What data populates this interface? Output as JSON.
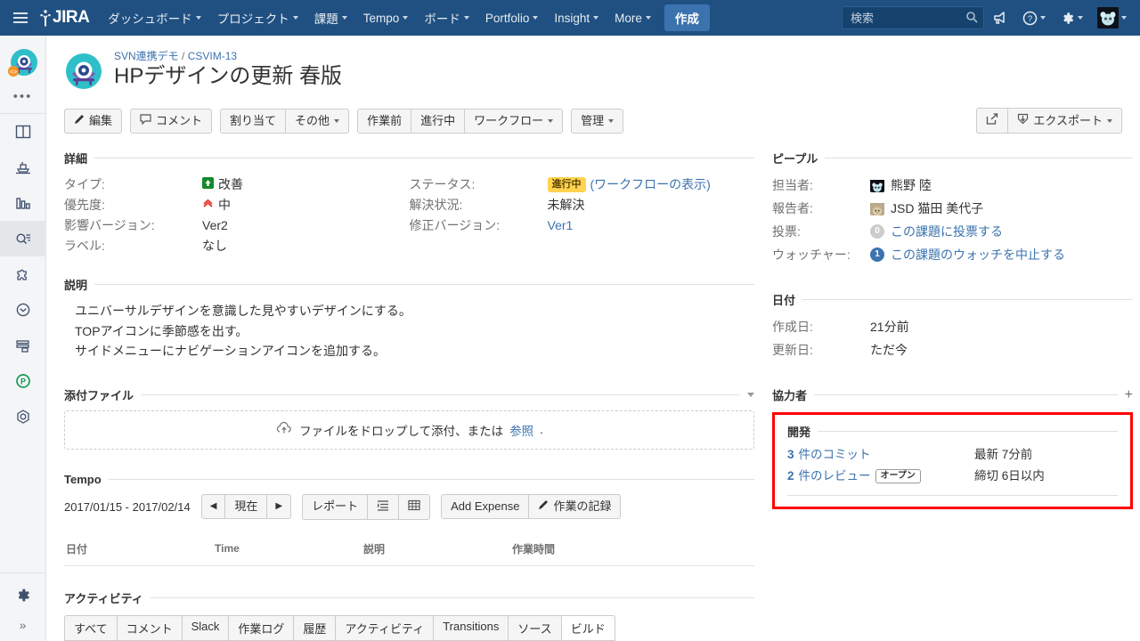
{
  "topnav": {
    "brand": "JIRA",
    "items": [
      {
        "label": "ダッシュボード",
        "caret": true
      },
      {
        "label": "プロジェクト",
        "caret": true
      },
      {
        "label": "課題",
        "caret": true
      },
      {
        "label": "Tempo",
        "caret": true
      },
      {
        "label": "ボード",
        "caret": true
      },
      {
        "label": "Portfolio",
        "caret": true
      },
      {
        "label": "Insight",
        "caret": true
      },
      {
        "label": "More",
        "caret": true
      }
    ],
    "create_label": "作成",
    "search_placeholder": "検索",
    "icons": [
      "megaphone-icon",
      "help-icon",
      "settings-icon",
      "user-avatar"
    ]
  },
  "rail": {
    "items": [
      {
        "name": "board-icon"
      },
      {
        "name": "backlog-icon"
      },
      {
        "name": "reports-icon"
      },
      {
        "name": "issues-search-icon",
        "active": true
      },
      {
        "name": "add-ons-icon"
      },
      {
        "name": "releases-icon"
      },
      {
        "name": "components-icon"
      },
      {
        "name": "portfolio-icon"
      },
      {
        "name": "settings-nut-icon"
      }
    ],
    "more_dots": "•••",
    "expand": "»"
  },
  "breadcrumb": {
    "project": "SVN連携デモ",
    "separator": "/",
    "issue_key": "CSVIM-13"
  },
  "issue": {
    "title": "HPデザインの更新 春版"
  },
  "toolbar": {
    "groups": [
      [
        {
          "label": "編集",
          "icon": "pencil-icon"
        }
      ],
      [
        {
          "label": "コメント",
          "icon": "comment-icon"
        }
      ],
      [
        {
          "label": "割り当て"
        },
        {
          "label": "その他",
          "caret": true
        }
      ],
      [
        {
          "label": "作業前"
        },
        {
          "label": "進行中"
        },
        {
          "label": "ワークフロー",
          "caret": true
        }
      ],
      [
        {
          "label": "管理",
          "caret": true
        }
      ]
    ],
    "share_icon": "share-icon",
    "export_label": "エクスポート"
  },
  "details": {
    "heading": "詳細",
    "left": [
      {
        "label": "タイプ:",
        "value": "改善",
        "icon": "improvement-icon"
      },
      {
        "label": "優先度:",
        "value": "中",
        "icon": "priority-medium-icon"
      },
      {
        "label": "影響バージョン:",
        "value": "Ver2"
      },
      {
        "label": "ラベル:",
        "value": "なし"
      }
    ],
    "right": [
      {
        "label": "ステータス:",
        "badge": "進行中",
        "link": "(ワークフローの表示)"
      },
      {
        "label": "解決状況:",
        "value": "未解決"
      },
      {
        "label": "修正バージョン:",
        "value": "Ver1",
        "is_link": true
      }
    ]
  },
  "description": {
    "heading": "説明",
    "lines": [
      "ユニバーサルデザインを意識した見やすいデザインにする。",
      "TOPアイコンに季節感を出す。",
      "サイドメニューにナビゲーションアイコンを追加する。"
    ]
  },
  "attachments": {
    "heading": "添付ファイル",
    "drop_text": "ファイルをドロップして添付、または",
    "browse_label": "参照",
    "trailing": "."
  },
  "tempo": {
    "heading": "Tempo",
    "range": "2017/01/15 - 2017/02/14",
    "prev": "◀",
    "current_label": "現在",
    "next": "▶",
    "report_label": "レポート",
    "list_icon": "list-view-icon",
    "grid_icon": "grid-view-icon",
    "add_expense_label": "Add Expense",
    "log_work_label": "作業の記録",
    "columns": [
      "日付",
      "Time",
      "説明",
      "作業時間"
    ]
  },
  "people": {
    "heading": "ピープル",
    "rows": [
      {
        "label": "担当者:",
        "value": "熊野 陸",
        "avatar": "assignee-avatar"
      },
      {
        "label": "報告者:",
        "value": "JSD 猫田 美代子",
        "avatar": "reporter-avatar"
      },
      {
        "label": "投票:",
        "count": "0",
        "link": "この課題に投票する",
        "badge_color": "#cccccc"
      },
      {
        "label": "ウォッチャー:",
        "count": "1",
        "link": "この課題のウォッチを中止する",
        "badge_color": "#3b73af"
      }
    ]
  },
  "dates": {
    "heading": "日付",
    "rows": [
      {
        "label": "作成日:",
        "value": "21分前"
      },
      {
        "label": "更新日:",
        "value": "ただ今"
      }
    ]
  },
  "collaborators": {
    "heading": "協力者",
    "add": "+"
  },
  "development": {
    "heading": "開発",
    "highlight_color": "#ff0000",
    "rows": [
      {
        "count": "3",
        "label": "件のコミット",
        "meta": "最新 7分前"
      },
      {
        "count": "2",
        "label": "件のレビュー",
        "pill": "オープン",
        "meta": "締切 6日以内"
      }
    ]
  },
  "activity": {
    "heading": "アクティビティ",
    "tabs": [
      {
        "label": "すべて",
        "active": false
      },
      {
        "label": "コメント",
        "active": false
      },
      {
        "label": "Slack",
        "active": false
      },
      {
        "label": "作業ログ",
        "active": false
      },
      {
        "label": "履歴",
        "active": false
      },
      {
        "label": "アクティビティ",
        "active": false
      },
      {
        "label": "Transitions",
        "active": false
      },
      {
        "label": "ソース",
        "active": false
      },
      {
        "label": "ビルド",
        "active": true
      }
    ]
  }
}
